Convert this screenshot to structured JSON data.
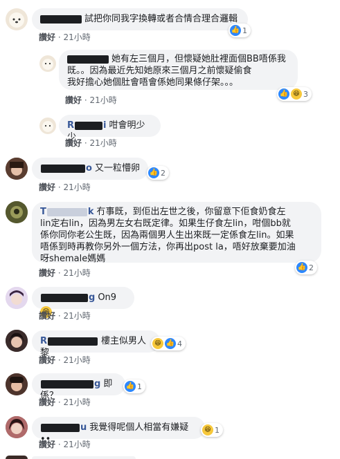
{
  "comments": [
    {
      "id": "c1",
      "author": "",
      "text": "試把你同我字換轉或者合情合理合邏輯",
      "like_label": "讚好",
      "time": "21小時",
      "reaction_count": "1"
    },
    {
      "id": "c2",
      "author": "",
      "text_lines": [
        "她有左三個月，但懷疑她肚裡面個BB唔係我",
        "既。。因為最近先知她原來三個月之前懷疑偷食",
        "我好擔心她個肚會唔會係她同果條仔架。。。"
      ],
      "like_label": "讚好",
      "time": "21小時",
      "reaction_count": "3"
    },
    {
      "id": "c3",
      "author_prefix": "R",
      "author_suffix": "i",
      "text": "咁會明少少",
      "like_label": "讚好",
      "time": "21小時"
    },
    {
      "id": "c4",
      "author": "",
      "author_suffix": "o",
      "text": "又一粒懵卵",
      "like_label": "讚好",
      "time": "21小時",
      "reaction_count": "2"
    },
    {
      "id": "c5",
      "author_prefix": "T",
      "author_suffix": "k",
      "text_first": "冇事既，到佢出左世之後，你留意下佢食奶食左",
      "text_lines": [
        "lin定右lin，因為男左女右既定律。如果生仔食左lin，咁個bb就",
        "係你同你老公生既，因為兩個男人生出來既一定係食左lin。如果",
        "唔係到時再教你另外一個方法，你再出post la，唔好放棄要加油",
        "呀shemale媽媽"
      ],
      "like_label": "讚好",
      "time": "21小時",
      "reaction_count": "2"
    },
    {
      "id": "c6",
      "author_prefix": "",
      "author_suffix": "g",
      "text": "On9",
      "like_label": "讚好",
      "time": "21小時"
    },
    {
      "id": "c7",
      "author_prefix": "R",
      "text": "樓主似男人黎",
      "like_label": "讚好",
      "time": "21小時",
      "reaction_count": "4"
    },
    {
      "id": "c8",
      "author_suffix": "g",
      "text": "即係？",
      "like_label": "讚好",
      "time": "21小時",
      "reaction_count": "1"
    },
    {
      "id": "c9",
      "author_suffix": "u",
      "text": "我覺得呢個人相當有嫌疑••",
      "like_label": "讚好",
      "time": "21小時",
      "reaction_count": "1"
    }
  ],
  "icons": {
    "like": "like-reaction-icon",
    "haha": "haha-reaction-icon"
  },
  "colors": {
    "bubble": "#f2f3f5",
    "link": "#385898",
    "like_blue": "#2d88ff",
    "haha_yellow": "#f7c83b"
  }
}
